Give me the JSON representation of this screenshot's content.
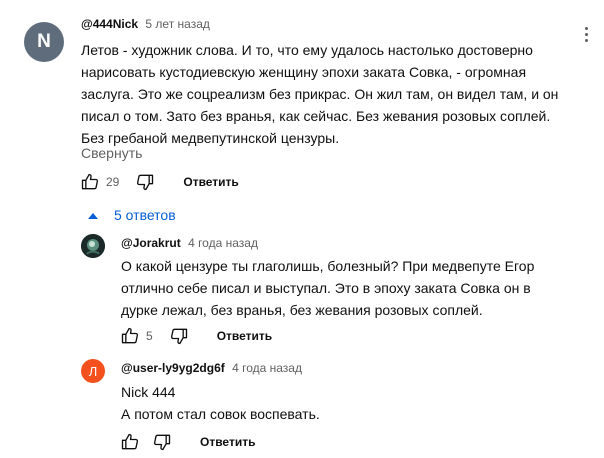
{
  "comment": {
    "avatar_letter": "N",
    "avatar_color": "#5f6c7b",
    "author": "@444Nick",
    "time": "5 лет назад",
    "lines": [
      "Летов - художник слова. И то, что ему удалось настолько достоверно",
      "нарисовать кустодиевскую женщину эпохи заката Совка, - огромная",
      "заслуга. Это же соцреализм без прикрас. Он жил там, он видел там, и он",
      "писал о том. Зато без вранья, как сейчас. Без жевания розовых соплей.",
      "Без гребаной медвепутинской цензуры."
    ],
    "collapse_label": "Свернуть",
    "likes": "29",
    "reply_label": "Ответить"
  },
  "replies_toggle": {
    "label": "5 ответов"
  },
  "replies": [
    {
      "author": "@Jorakrut",
      "time": "4 года назад",
      "lines": [
        "О какой цензуре ты глаголишь, болезный? При медвепуте Егор",
        "отлично себе писал и выступал. Это в эпоху заката Совка он в",
        "дурке лежал, без вранья, без жевания розовых соплей."
      ],
      "likes": "5",
      "reply_label": "Ответить"
    },
    {
      "avatar_letter": "Л",
      "avatar_color": "#f4511e",
      "author": "@user-ly9yg2dg6f",
      "time": "4 года назад",
      "lines": [
        "Nick 444",
        "А потом стал совок воспевать."
      ],
      "reply_label": "Ответить"
    }
  ]
}
